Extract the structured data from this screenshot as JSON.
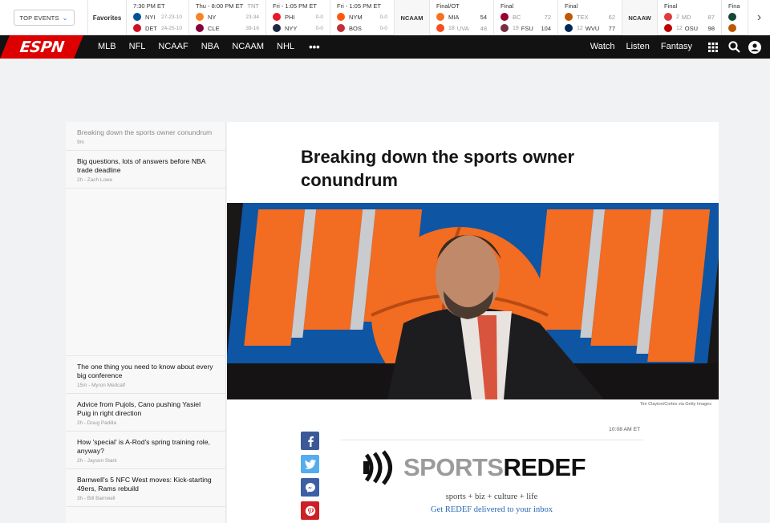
{
  "scorebar": {
    "top_events_label": "TOP EVENTS",
    "favorites_label": "Favorites",
    "ncaam_label": "NCAAM",
    "ncaaw_label": "NCAAW",
    "games": [
      {
        "status": "7:30 PM ET",
        "network": "",
        "teams": [
          {
            "name": "NYI",
            "record": "27-23-10",
            "score": "",
            "color": "#00539b",
            "lose": false
          },
          {
            "name": "DET",
            "record": "24-25-10",
            "score": "",
            "color": "#ce1126",
            "lose": false
          }
        ]
      },
      {
        "status": "Thu - 8:00 PM ET",
        "network": "TNT",
        "teams": [
          {
            "name": "NY",
            "record": "23-34",
            "score": "",
            "color": "#f58426",
            "lose": false
          },
          {
            "name": "CLE",
            "record": "39-16",
            "score": "",
            "color": "#860038",
            "lose": false
          }
        ]
      },
      {
        "status": "Fri - 1:05 PM ET",
        "network": "",
        "teams": [
          {
            "name": "PHI",
            "record": "",
            "score": "0-0",
            "color": "#e81828",
            "lose": false
          },
          {
            "name": "NYY",
            "record": "",
            "score": "0-0",
            "color": "#1c2841",
            "lose": false
          }
        ]
      },
      {
        "status": "Fri - 1:05 PM ET",
        "network": "",
        "teams": [
          {
            "name": "NYM",
            "record": "",
            "score": "0-0",
            "color": "#ff5910",
            "lose": false
          },
          {
            "name": "BOS",
            "record": "",
            "score": "0-0",
            "color": "#bd3039",
            "lose": false
          }
        ]
      }
    ],
    "ncaam_games": [
      {
        "status": "Final/OT",
        "teams": [
          {
            "rank": "",
            "name": "MIA",
            "score": "54",
            "color": "#f47321",
            "lose": false
          },
          {
            "rank": "18",
            "name": "UVA",
            "score": "48",
            "color": "#f84c1e",
            "lose": true
          }
        ]
      },
      {
        "status": "Final",
        "teams": [
          {
            "rank": "",
            "name": "BC",
            "score": "72",
            "color": "#98002e",
            "lose": true
          },
          {
            "rank": "19",
            "name": "FSU",
            "score": "104",
            "color": "#782f40",
            "lose": false
          }
        ]
      },
      {
        "status": "Final",
        "teams": [
          {
            "rank": "",
            "name": "TEX",
            "score": "62",
            "color": "#bf5700",
            "lose": true
          },
          {
            "rank": "12",
            "name": "WVU",
            "score": "77",
            "color": "#002855",
            "lose": false
          }
        ]
      }
    ],
    "ncaaw_games": [
      {
        "status": "Final",
        "teams": [
          {
            "rank": "2",
            "name": "MD",
            "score": "87",
            "color": "#e03a3e",
            "lose": true
          },
          {
            "rank": "12",
            "name": "OSU",
            "score": "98",
            "color": "#bb0000",
            "lose": false
          }
        ]
      },
      {
        "status": "Fina",
        "teams": [
          {
            "rank": "",
            "name": "",
            "score": "",
            "color": "#154734",
            "lose": false
          },
          {
            "rank": "",
            "name": "",
            "score": "",
            "color": "#bf5700",
            "lose": false
          }
        ]
      }
    ]
  },
  "nav": {
    "logo": "ESPN",
    "items": [
      "MLB",
      "NFL",
      "NCAAF",
      "NBA",
      "NCAAM",
      "NHL"
    ],
    "more": "•••",
    "right": [
      "Watch",
      "Listen",
      "Fantasy"
    ]
  },
  "rail": {
    "items": [
      {
        "title": "Breaking down the sports owner conundrum",
        "meta": "9m",
        "active": true
      },
      {
        "title": "Big questions, lots of answers before NBA trade deadline",
        "meta": "2h - Zach Lowe"
      },
      {
        "title": "The one thing you need to know about every big conference",
        "meta": "15m - Myron Medcalf"
      },
      {
        "title": "Advice from Pujols, Cano pushing Yasiel Puig in right direction",
        "meta": "2h - Doug Padilla"
      },
      {
        "title": "How 'special' is A-Rod's spring training role, anyway?",
        "meta": "2h - Jayson Stark"
      },
      {
        "title": "Barnwell's 5 NFC West moves: Kick-starting 49ers, Rams rebuild",
        "meta": "3h - Bill Barnwell"
      }
    ]
  },
  "article": {
    "headline": "Breaking down the sports owner conundrum",
    "photo_credit": "Tim Clayton/Corbis via Getty Images",
    "timestamp": "10:08 AM ET",
    "redef": {
      "brand_left": "SPORTS",
      "brand_right": "REDEF",
      "tagline": "sports + biz + culture + life",
      "link": "Get REDEF delivered to your inbox"
    }
  },
  "colors": {
    "espn_red": "#dd0000",
    "nav_bg": "#121213",
    "facebook": "#3b5998",
    "twitter": "#55acee",
    "messenger": "#3c5fa5",
    "pinterest": "#cb2027",
    "link": "#2a68b5"
  }
}
